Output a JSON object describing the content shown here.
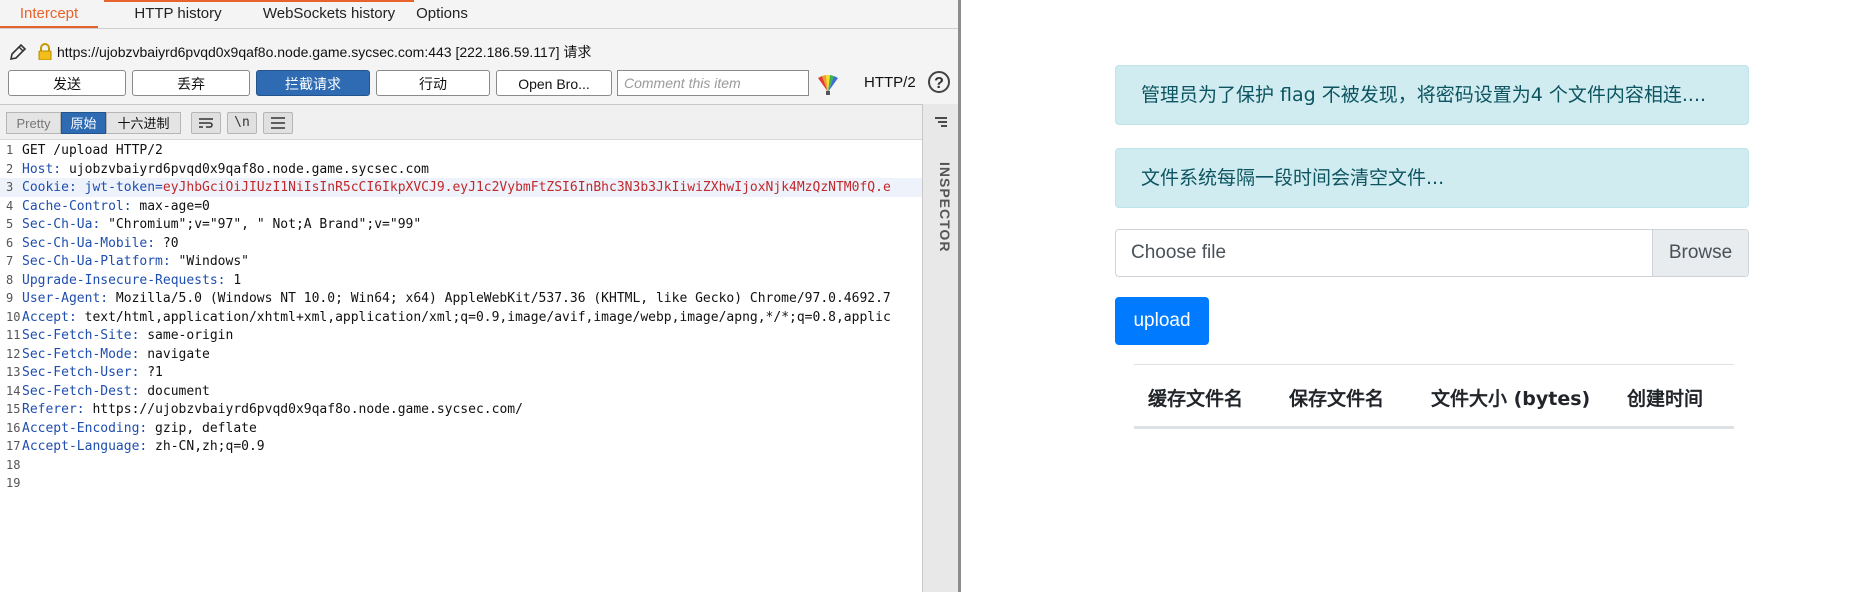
{
  "burp": {
    "tabs": [
      "Intercept",
      "HTTP history",
      "WebSockets history",
      "Options"
    ],
    "url": "https://ujobzvbaiyrd6pvqd0x9qaf8o.node.game.sycsec.com:443  [222.186.59.117] 请求",
    "buttons": {
      "forward": "发送",
      "drop": "丢弃",
      "intercept": "拦截请求",
      "action": "行动",
      "open_browser": "Open Bro..."
    },
    "comment_placeholder": "Comment this item",
    "protocol": "HTTP/2",
    "help": "?",
    "view_modes": {
      "pretty": "Pretty",
      "raw": "原始",
      "hex": "十六进制"
    },
    "toolbar_icons": {
      "wrap": "≡",
      "newline": "\\n",
      "menu": "≡"
    },
    "inspector": "INSPECTOR",
    "lines": [
      {
        "num": "1",
        "name": "",
        "value": "GET /upload HTTP/2"
      },
      {
        "num": "2",
        "name": "Host:",
        "value": " ujobzvbaiyrd6pvqd0x9qaf8o.node.game.sycsec.com"
      },
      {
        "num": "3",
        "name": "Cookie: jwt-token=",
        "value": "eyJhbGciOiJIUzI1NiIsInR5cCI6IkpXVCJ9.eyJ1c2VybmFtZSI6InBhc3N3b3JkIiwiZXhwIjoxNjk4MzQzNTM0fQ.e"
      },
      {
        "num": "4",
        "name": "Cache-Control:",
        "value": " max-age=0"
      },
      {
        "num": "5",
        "name": "Sec-Ch-Ua:",
        "value": " \"Chromium\";v=\"97\", \" Not;A Brand\";v=\"99\""
      },
      {
        "num": "6",
        "name": "Sec-Ch-Ua-Mobile:",
        "value": " ?0"
      },
      {
        "num": "7",
        "name": "Sec-Ch-Ua-Platform:",
        "value": " \"Windows\""
      },
      {
        "num": "8",
        "name": "Upgrade-Insecure-Requests:",
        "value": " 1"
      },
      {
        "num": "9",
        "name": "User-Agent:",
        "value": " Mozilla/5.0 (Windows NT 10.0; Win64; x64) AppleWebKit/537.36 (KHTML, like Gecko) Chrome/97.0.4692.7"
      },
      {
        "num": "10",
        "name": "Accept:",
        "value": " text/html,application/xhtml+xml,application/xml;q=0.9,image/avif,image/webp,image/apng,*/*;q=0.8,applic"
      },
      {
        "num": "11",
        "name": "Sec-Fetch-Site:",
        "value": " same-origin"
      },
      {
        "num": "12",
        "name": "Sec-Fetch-Mode:",
        "value": " navigate"
      },
      {
        "num": "13",
        "name": "Sec-Fetch-User:",
        "value": " ?1"
      },
      {
        "num": "14",
        "name": "Sec-Fetch-Dest:",
        "value": " document"
      },
      {
        "num": "15",
        "name": "Referer:",
        "value": " https://ujobzvbaiyrd6pvqd0x9qaf8o.node.game.sycsec.com/"
      },
      {
        "num": "16",
        "name": "Accept-Encoding:",
        "value": " gzip, deflate"
      },
      {
        "num": "17",
        "name": "Accept-Language:",
        "value": " zh-CN,zh;q=0.9"
      },
      {
        "num": "18",
        "name": "",
        "value": ""
      },
      {
        "num": "19",
        "name": "",
        "value": ""
      }
    ]
  },
  "web": {
    "alert1": "管理员为了保护 flag 不被发现，将密码设置为4 个文件内容相连....",
    "alert2": "文件系统每隔一段时间会清空文件...",
    "file_placeholder": "Choose file",
    "browse": "Browse",
    "upload": "upload",
    "table_headers": [
      "缓存文件名",
      "保存文件名",
      "文件大小 (bytes)",
      "创建时间"
    ]
  },
  "colors": {
    "burp_accent": "#e8622c",
    "burp_primary": "#2f6bb3",
    "header_name": "#1f4eaf",
    "cookie_value": "#c0282b",
    "alert_bg": "#d1ecf1",
    "alert_text": "#0c5460",
    "upload_btn": "#007bff"
  }
}
